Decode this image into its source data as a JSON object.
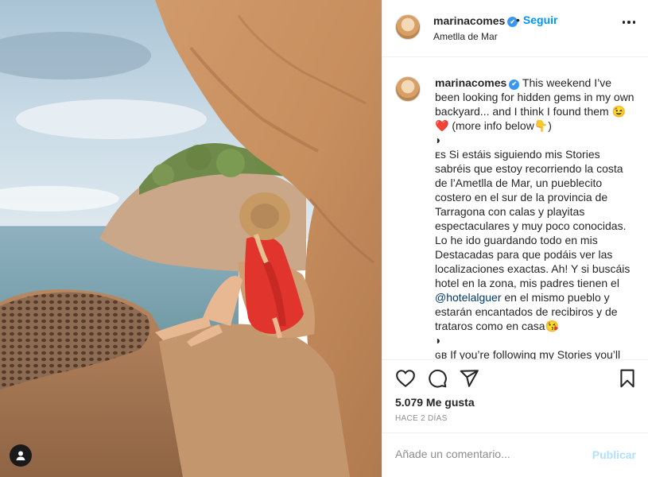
{
  "post": {
    "username": "marinacomes",
    "verified_mark": "✔",
    "dot": "•",
    "follow_label": "Seguir",
    "location": "Ametlla de Mar",
    "caption_parts": [
      "This weekend I’ve been looking for hidden gems in my own backyard... and I think I found them 😉❤️ (more info below👇)\n◗\nᴇs Si estáis siguiendo mis Stories sabréis que estoy recorriendo la costa de l’Ametlla de Mar, un pueblecito costero en el sur de la provincia de Tarragona con calas y playitas espectaculares y muy poco conocidas. Lo he ido guardando todo en mis Destacadas para que podáis ver las localizaciones exactas. Ah! Y si buscáis hotel en la zona, mis padres tienen el ",
      "@hotelalguer",
      " en el mismo pueblo y estarán encantados de recibiros y de trataros como en casa😘\n◗\nɢʙ If you’re following my Stories you’ll"
    ],
    "likes": "5.079 Me gusta",
    "timestamp": "HACE 2 DÍAS",
    "comment_placeholder": "Añade un comentario...",
    "publish_label": "Publicar"
  },
  "icons": {
    "like": "heart-icon",
    "comment": "comment-icon",
    "share": "paper-plane-icon",
    "save": "bookmark-icon",
    "more": "more-options-icon",
    "tags": "user-tag-icon"
  },
  "colors": {
    "link": "#0095f6",
    "mention": "#00376b",
    "verified": "#3897f0",
    "muted": "#8e8e8e",
    "publish_disabled": "#b2dffc"
  }
}
